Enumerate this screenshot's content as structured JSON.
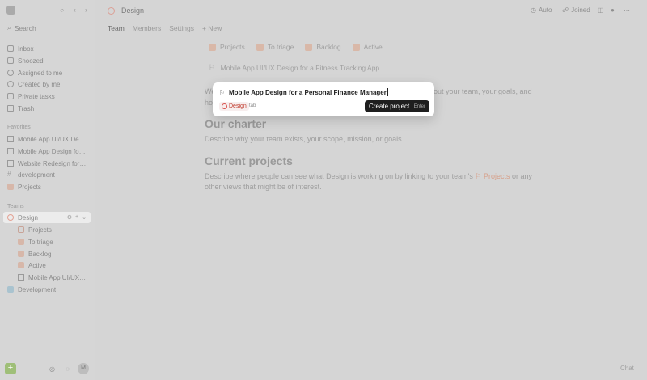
{
  "sidebar": {
    "search_placeholder": "Search",
    "nav": [
      {
        "label": "Inbox",
        "icon": "inbox-icon"
      },
      {
        "label": "Snoozed",
        "icon": "snooze-icon"
      },
      {
        "label": "Assigned to me",
        "icon": "assigned-icon"
      },
      {
        "label": "Created by me",
        "icon": "created-icon"
      },
      {
        "label": "Private tasks",
        "icon": "lock-icon"
      },
      {
        "label": "Trash",
        "icon": "trash-icon"
      }
    ],
    "favorites_title": "Favorites",
    "favorites": [
      {
        "label": "Mobile App UI/UX Desi..."
      },
      {
        "label": "Mobile App Design for ..."
      },
      {
        "label": "Website Redesign for a..."
      },
      {
        "label": "development"
      },
      {
        "label": "Projects"
      }
    ],
    "teams_title": "Teams",
    "teams": [
      {
        "label": "Design"
      },
      {
        "label": "Development"
      }
    ],
    "design_children": [
      {
        "label": "Projects"
      },
      {
        "label": "To triage"
      },
      {
        "label": "Backlog"
      },
      {
        "label": "Active"
      },
      {
        "label": "Mobile App UI/UX ..."
      }
    ],
    "avatar_initial": "M"
  },
  "header": {
    "breadcrumb": "Design",
    "auto_label": "Auto",
    "joined_label": "Joined"
  },
  "tabs": [
    "Team",
    "Members",
    "Settings",
    "+ New"
  ],
  "chips": [
    "Projects",
    "To triage",
    "Backlog",
    "Active"
  ],
  "project_line": "Mobile App UI/UX Design for a Fitness Tracking App",
  "intro_left": "We",
  "intro_right": "bout your team, your goals, and",
  "intro_second": "ho",
  "charter_title": "Our charter",
  "charter_text": "Describe why your team exists, your scope, mission, or goals",
  "current_title": "Current projects",
  "current_text_1": "Describe where people can see what Design is working on by linking to your team's",
  "current_inline_chip": "Projects",
  "current_text_2": "or any",
  "current_text_3": "other views that might be of interest.",
  "chat_label": "Chat",
  "modal": {
    "input_value": "Mobile App Design for a Personal Finance Manager",
    "team_chip": "Design",
    "tab_hint": "tab",
    "create_label": "Create project",
    "create_key": "Enter"
  },
  "colors": {
    "accent": "#1e1e1e",
    "design": "#d9534f",
    "new": "#9fbf78"
  }
}
